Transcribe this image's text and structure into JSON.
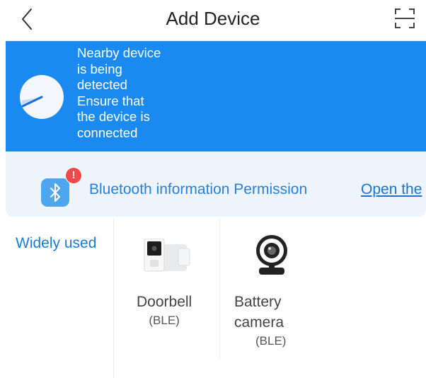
{
  "header": {
    "title": "Add Device",
    "back_icon": "chevron-left-icon",
    "scan_icon": "scan-icon"
  },
  "scan_banner": {
    "lines": [
      "Nearby device",
      "is being",
      "detected",
      "Ensure that",
      "the device is",
      "connected"
    ],
    "color": "#1b8af0"
  },
  "permission_bar": {
    "icon": "bluetooth-icon",
    "badge": "!",
    "text": "Bluetooth information Permission",
    "link": "Open the"
  },
  "categories": [
    {
      "label": "Widely used"
    }
  ],
  "devices": [
    {
      "name": "Doorbell",
      "sub": "(BLE)",
      "icon": "doorbell-icon"
    },
    {
      "name_line1": "Battery",
      "name_line2": "camera",
      "sub": "(BLE)",
      "icon": "camera-icon"
    }
  ]
}
